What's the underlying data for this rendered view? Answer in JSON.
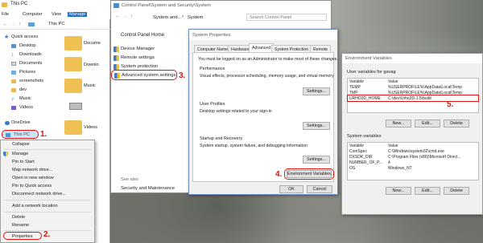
{
  "explorer": {
    "title": "This PC",
    "ribbon_tabs": [
      "File",
      "Computer",
      "View",
      "Manage"
    ],
    "address": "This PC",
    "nav": [
      "Quick access",
      "Desktop",
      "Downloads",
      "Documents",
      "Pictures",
      "screenshots",
      "dev",
      "Music",
      "Videos",
      "OneDrive",
      "This PC"
    ],
    "tiles": [
      "Docume",
      "Downlo",
      "Music",
      "Videos"
    ],
    "step1": "1.",
    "step2": "2."
  },
  "context_menu": {
    "items": [
      "Collapse",
      "Manage",
      "Pin to Start",
      "Map network drive...",
      "Open in new window",
      "Pin to Quick access",
      "Disconnect network drive...",
      "Add a network location",
      "Delete",
      "Rename",
      "Properties"
    ]
  },
  "control_panel": {
    "title": "Control Panel\\System and Security\\System",
    "breadcrumb": [
      "System and...",
      "System"
    ],
    "search_placeholder": "Search Control Panel",
    "home": "Control Panel Home",
    "links": [
      "Device Manager",
      "Remote settings",
      "System protection",
      "Advanced system settings"
    ],
    "see_also": "See also",
    "security": "Security and Maintenance",
    "step3": "3."
  },
  "system_properties": {
    "title": "System Properties",
    "tabs": [
      "Computer Name",
      "Hardware",
      "Advanced",
      "System Protection",
      "Remote"
    ],
    "admin_note": "You must be logged on as an Administrator to make most of these changes.",
    "performance_title": "Performance",
    "performance_desc": "Visual effects, processor scheduling, memory usage, and virtual memory",
    "user_profiles_title": "User Profiles",
    "user_profiles_desc": "Desktop settings related to your sign-in",
    "startup_title": "Startup and Recovery",
    "startup_desc": "System startup, system failure, and debugging information",
    "settings_label": "Settings...",
    "env_button": "Environment Variables...",
    "ok": "OK",
    "cancel": "Cancel",
    "step4": "4."
  },
  "env_vars": {
    "title": "Environment Variables",
    "user_heading": "User variables for gavag",
    "col_var": "Variable",
    "col_val": "Value",
    "user_rows": [
      [
        "TEMP",
        "%USERPROFILE%\\AppData\\Local\\Temp"
      ],
      [
        "TMP",
        "%USERPROFILE%\\AppData\\Local\\Temp"
      ],
      [
        "URHO3D_HOME",
        "C:\\dev\\Urho3D-1.5\\build"
      ]
    ],
    "new": "New...",
    "edit": "Edit...",
    "delete": "Delete",
    "sys_heading": "System variables",
    "sys_rows": [
      [
        "ComSpec",
        "C:\\Windows\\system32\\cmd.exe"
      ],
      [
        "DXSDK_DIR",
        "C:\\Program Files (x86)\\Microsoft Direct..."
      ],
      [
        "NUMBER_OF_P...",
        "4"
      ],
      [
        "OS",
        "Windows_NT"
      ]
    ],
    "step5": "5."
  },
  "colors": {
    "accent": "#1e6fc8",
    "annotation": "#d4160f"
  }
}
